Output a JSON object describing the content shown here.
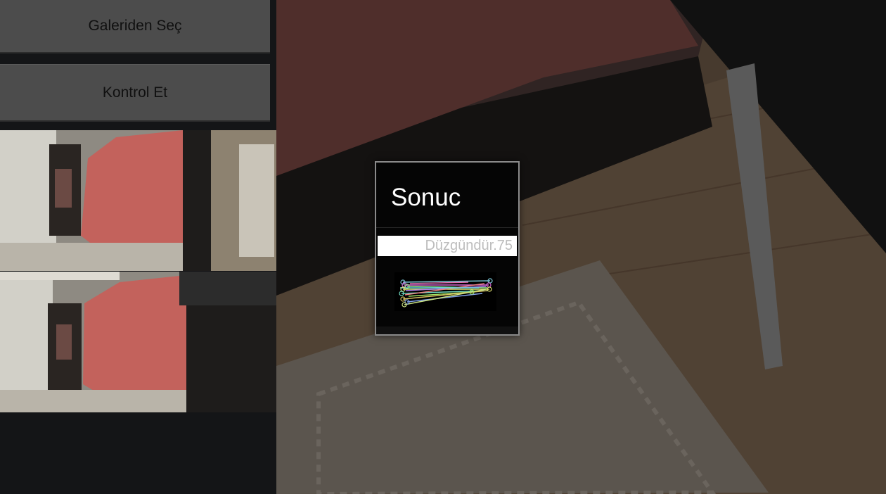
{
  "left_panel": {
    "gallery_button_label": "Galeriden Seç",
    "check_button_label": "Kontrol Et"
  },
  "dialog": {
    "title": "Sonuc",
    "result_text": "Düzgündür.",
    "score": "75"
  },
  "colors": {
    "button_bg": "#4c4c4c",
    "panel_bg": "#141517",
    "dialog_bg": "#050505",
    "bedspread": "#b9615c"
  }
}
